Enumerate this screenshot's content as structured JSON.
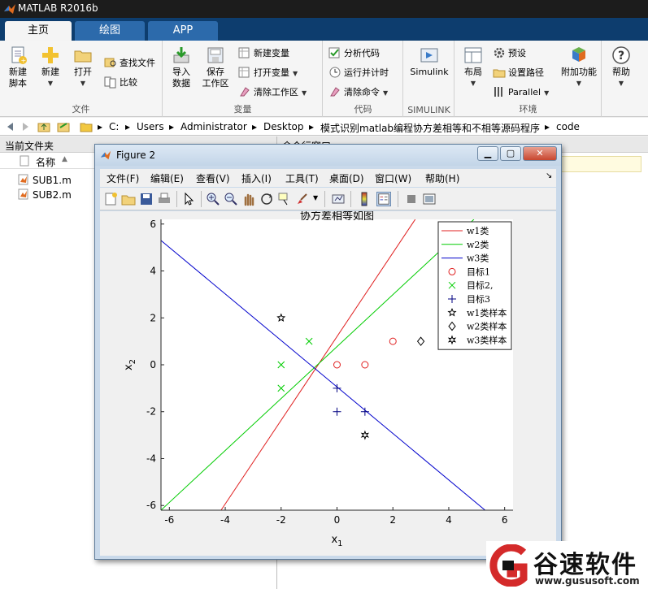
{
  "app": {
    "title": "MATLAB R2016b"
  },
  "tabs": [
    {
      "label": "主页",
      "active": true
    },
    {
      "label": "绘图",
      "active": false
    },
    {
      "label": "APP",
      "active": false
    }
  ],
  "ribbon": {
    "file_group": {
      "label": "文件",
      "new_script": "新建\n脚本",
      "new": "新建",
      "open": "打开",
      "find_files": "查找文件",
      "compare": "比较"
    },
    "variable_group": {
      "label": "变量",
      "import_data": "导入\n数据",
      "save_workspace": "保存\n工作区",
      "new_variable": "新建变量",
      "open_variable": "打开变量",
      "clear_workspace": "清除工作区"
    },
    "code_group": {
      "label": "代码",
      "analyze_code": "分析代码",
      "run_and_time": "运行并计时",
      "clear_commands": "清除命令"
    },
    "simulink_group": {
      "label": "SIMULINK",
      "simulink": "Simulink"
    },
    "environment_group": {
      "label": "环境",
      "layout": "布局",
      "preferences": "预设",
      "set_path": "设置路径",
      "parallel": "Parallel"
    },
    "addons": "附加功能",
    "help": "帮助"
  },
  "address": {
    "path": [
      "C:",
      "Users",
      "Administrator",
      "Desktop",
      "模式识别matlab编程协方差相等和不相等源码程序",
      "code"
    ]
  },
  "current_folder": {
    "title": "当前文件夹",
    "column_name": "名称",
    "files": [
      "SUB1.m",
      "SUB2.m"
    ]
  },
  "command_window": {
    "title": "命令行窗口"
  },
  "figure": {
    "title": "Figure 2",
    "menu": [
      "文件(F)",
      "编辑(E)",
      "查看(V)",
      "插入(I)",
      "工具(T)",
      "桌面(D)",
      "窗口(W)",
      "帮助(H)"
    ]
  },
  "chart_data": {
    "type": "line",
    "title": "协方差相等如图",
    "xlabel": "x1",
    "ylabel": "x2",
    "xlim": [
      -6.3,
      6.3
    ],
    "ylim": [
      -6.2,
      6.2
    ],
    "xticks": [
      -6,
      -4,
      -2,
      0,
      2,
      4,
      6
    ],
    "yticks": [
      -6,
      -4,
      -2,
      0,
      2,
      4,
      6
    ],
    "grid": false,
    "legend_position": "top-right",
    "lines": [
      {
        "name": "w1类",
        "color": "#e02020",
        "x": [
          -4.15,
          2.8
        ],
        "y": [
          -6.2,
          6.2
        ]
      },
      {
        "name": "w2类",
        "color": "#00cc00",
        "x": [
          -6.3,
          4.9
        ],
        "y": [
          -6.2,
          6.2
        ]
      },
      {
        "name": "w3类",
        "color": "#0000cc",
        "x": [
          -6.3,
          5.3
        ],
        "y": [
          5.3,
          -6.2
        ]
      }
    ],
    "points": [
      {
        "name": "目标1",
        "marker": "circle",
        "color": "#e02020",
        "x": [
          0,
          1,
          2
        ],
        "y": [
          0,
          0,
          1
        ]
      },
      {
        "name": "目标2,",
        "marker": "x",
        "color": "#00cc00",
        "x": [
          -2,
          -2,
          -1
        ],
        "y": [
          0,
          -1,
          1
        ]
      },
      {
        "name": "目标3",
        "marker": "plus",
        "color": "#000080",
        "x": [
          0,
          0,
          1
        ],
        "y": [
          -1,
          -2,
          -2
        ]
      },
      {
        "name": "w1类样本",
        "marker": "pentagram",
        "color": "#000000",
        "x": [
          -2
        ],
        "y": [
          2
        ]
      },
      {
        "name": "w2类样本",
        "marker": "diamond",
        "color": "#000000",
        "x": [
          3
        ],
        "y": [
          1
        ]
      },
      {
        "name": "w3类样本",
        "marker": "hexagram",
        "color": "#000000",
        "x": [
          1
        ],
        "y": [
          -3
        ]
      }
    ]
  },
  "watermark": {
    "name": "谷速软件",
    "url": "www.gususoft.com"
  }
}
